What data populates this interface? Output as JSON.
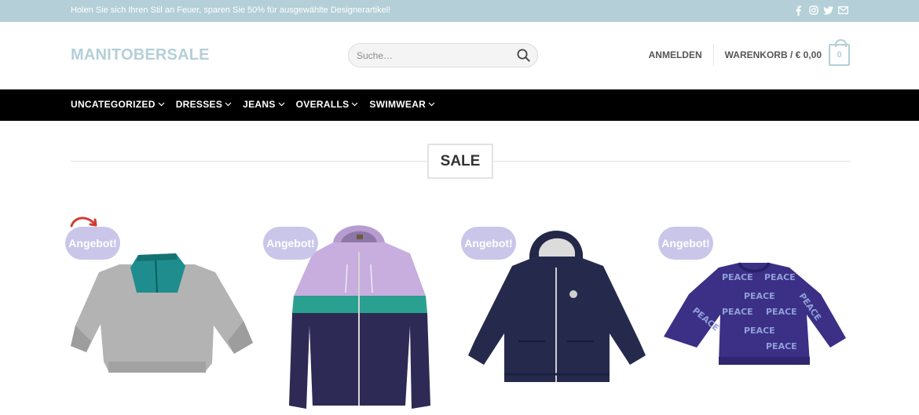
{
  "topbar": {
    "promo": "Holen Sie sich Ihren Stil an Feuer, sparen Sie 50% für ausgewählte Designerartikel!",
    "social_icons": [
      "facebook-icon",
      "instagram-icon",
      "twitter-icon",
      "envelope-icon"
    ]
  },
  "header": {
    "logo": "MANITOBERSALE",
    "search_placeholder": "Suche…",
    "login": "ANMELDEN",
    "cart_label": "WARENKORB / € 0,00",
    "cart_count": "0"
  },
  "nav": {
    "items": [
      {
        "label": "UNCATEGORIZED"
      },
      {
        "label": "DRESSES"
      },
      {
        "label": "JEANS"
      },
      {
        "label": "OVERALLS"
      },
      {
        "label": "SWIMWEAR"
      }
    ]
  },
  "section": {
    "title": "SALE"
  },
  "products": [
    {
      "badge": "Angebot!",
      "image": "grey-sweater-teal-collar"
    },
    {
      "badge": "Angebot!",
      "image": "purple-teal-navy-hoodie-jacket"
    },
    {
      "badge": "Angebot!",
      "image": "navy-hooded-coat"
    },
    {
      "badge": "Angebot!",
      "image": "purple-peace-sweater"
    }
  ],
  "colors": {
    "accent": "#b4cfd8",
    "nav_bg": "#000000",
    "badge": "#c9c6ea"
  }
}
